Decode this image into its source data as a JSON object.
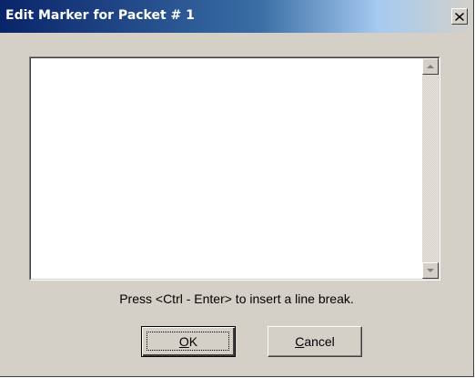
{
  "window": {
    "title": "Edit Marker for Packet # 1",
    "close_icon": "close-icon"
  },
  "editor": {
    "value": "",
    "scroll_up_icon": "arrow-up-icon",
    "scroll_down_icon": "arrow-down-icon"
  },
  "hint": "Press <Ctrl - Enter> to insert a line break.",
  "buttons": {
    "ok": {
      "accel": "O",
      "rest": "K"
    },
    "cancel": {
      "accel": "C",
      "rest": "ancel"
    }
  },
  "colors": {
    "face": "#d4d0c8",
    "title_start": "#0a246a",
    "title_end": "#a6caf0"
  }
}
